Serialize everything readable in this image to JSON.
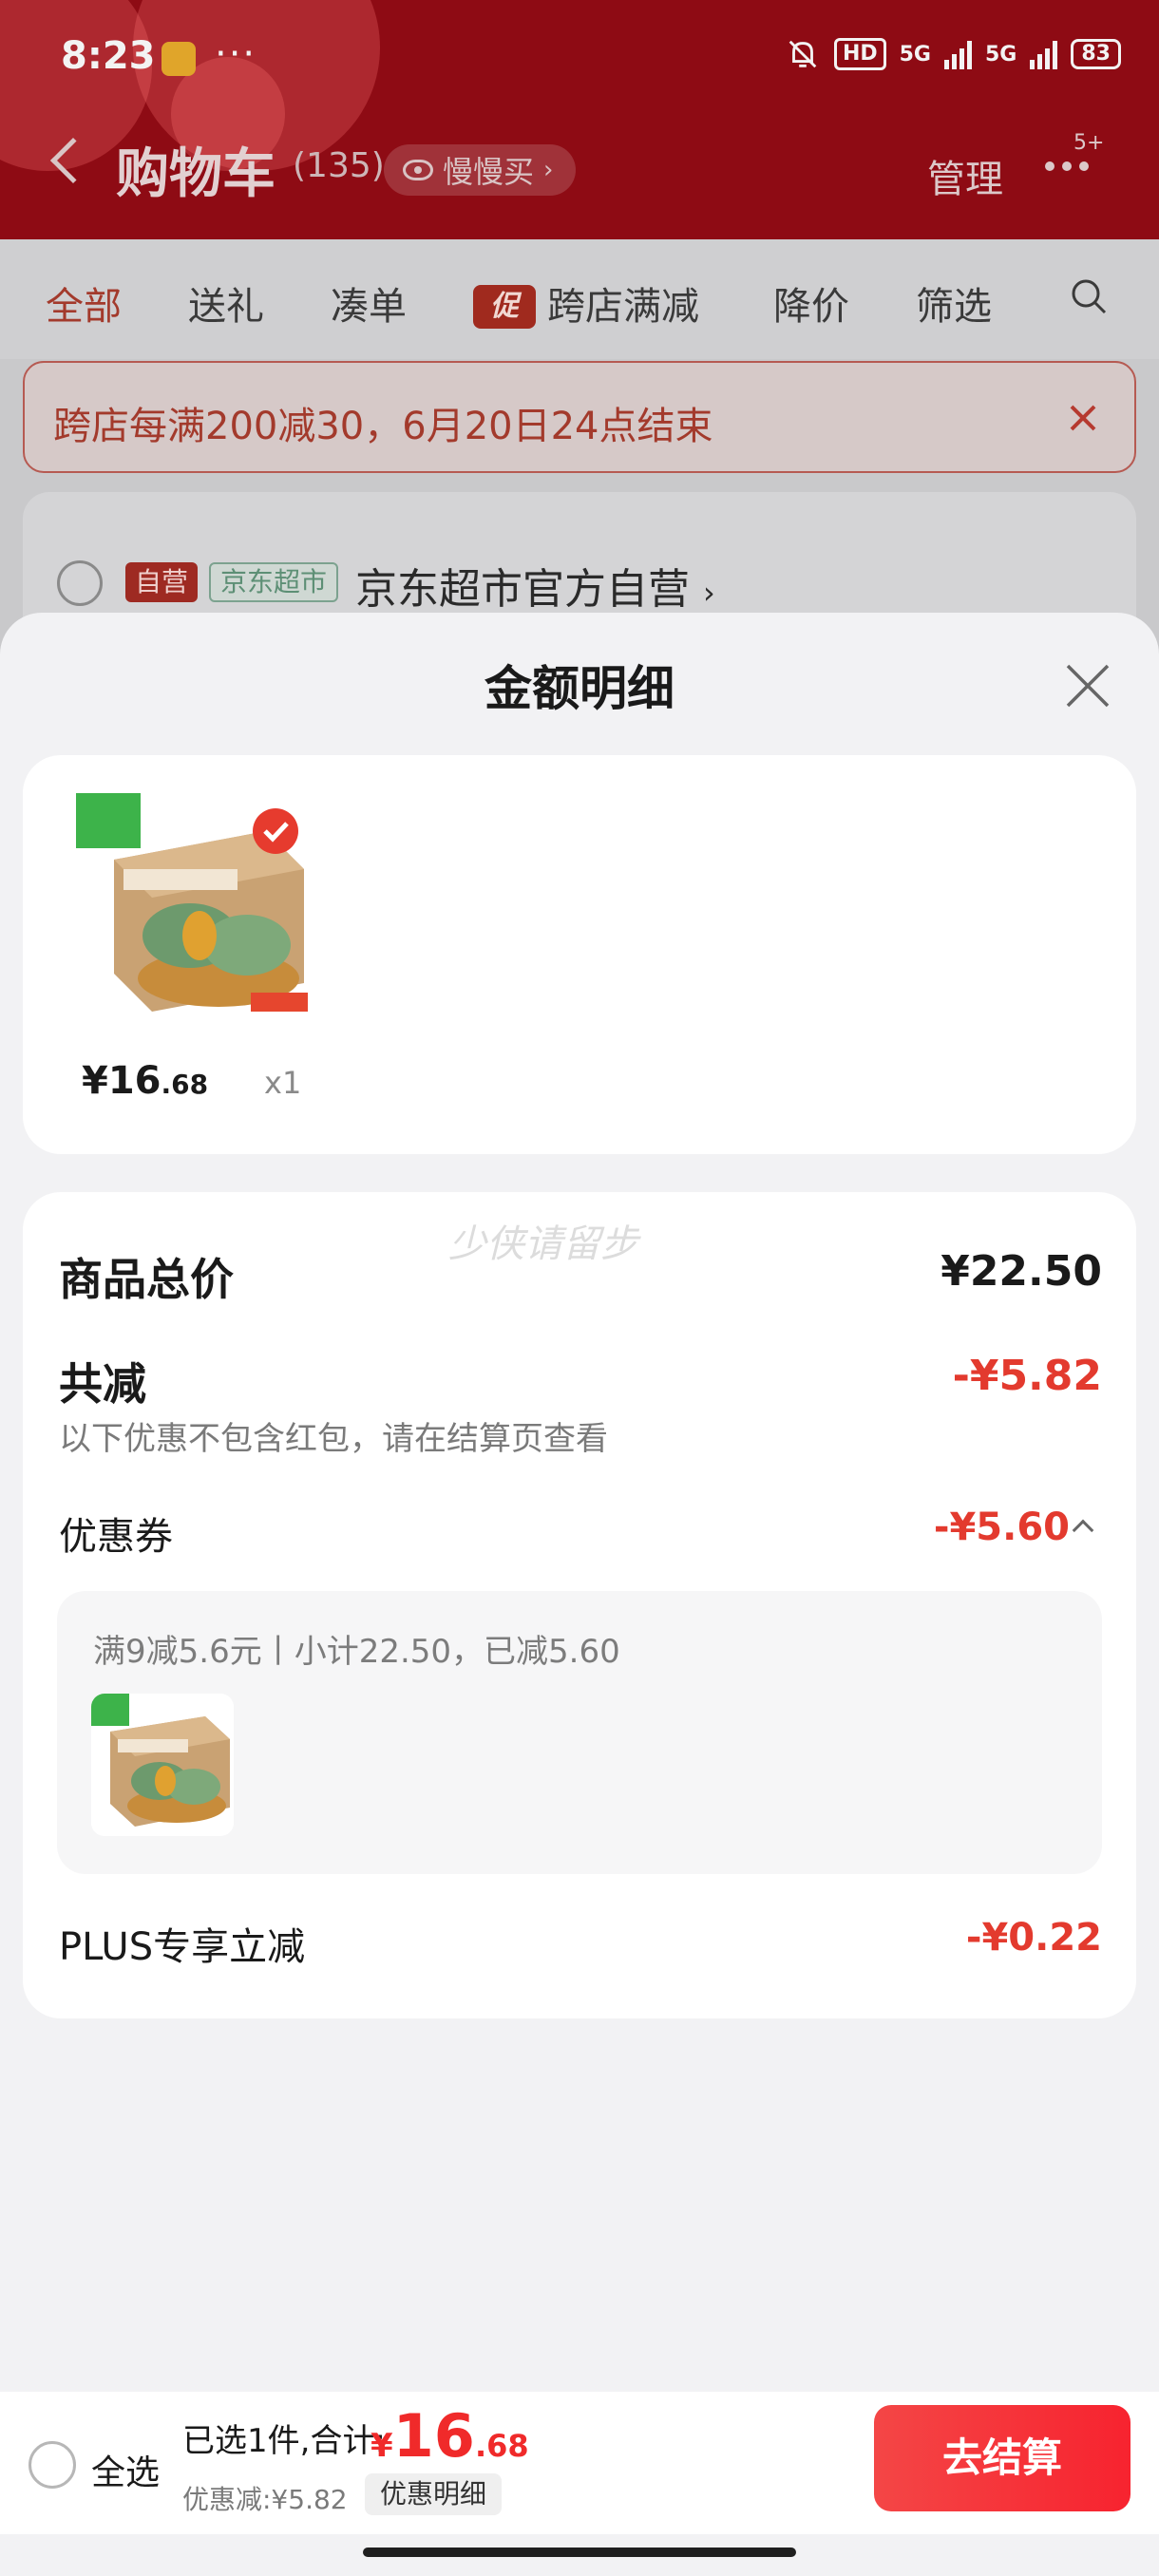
{
  "status": {
    "time": "8:23",
    "dots": "···",
    "hd": "HD",
    "net1": "5G",
    "net2": "5G",
    "battery": "83"
  },
  "nav": {
    "title": "购物车",
    "count": "(135)",
    "slow_buy": "慢慢买",
    "manage": "管理",
    "more_badge": "5+"
  },
  "tabs": {
    "all": "全部",
    "gift": "送礼",
    "bundle": "凑单",
    "promo_tag": "促",
    "cross_store": "跨店满减",
    "price_drop": "降价",
    "filter": "筛选"
  },
  "banner": {
    "text": "跨店每满200减30，6月20日24点结束"
  },
  "store": {
    "tag_self": "自营",
    "tag_jd": "京东超市",
    "name": "京东超市官方自营"
  },
  "sheet": {
    "title": "金额明细",
    "item": {
      "price_int": "¥16",
      "price_dec": ".68",
      "qty": "x1"
    },
    "watermark": "少侠请留步",
    "total_label": "商品总价",
    "total_value": "¥22.50",
    "reduce_label": "共减",
    "reduce_value": "-¥5.82",
    "reduce_note": "以下优惠不包含红包，请在结算页查看",
    "coupon_label": "优惠券",
    "coupon_value": "-¥5.60",
    "coupon_desc": "满9减5.6元丨小计22.50，已减5.60",
    "plus_label": "PLUS专享立减",
    "plus_value": "-¥0.22"
  },
  "checkout": {
    "select_all": "全选",
    "summary": "已选1件,合计:",
    "currency": "¥",
    "total_int": "16",
    "total_dec": ".68",
    "discount": "优惠减:¥5.82",
    "discount_detail": "优惠明细",
    "button": "去结算"
  },
  "colors": {
    "header_red": "#8e0b14",
    "accent_red": "#e33a2e",
    "checkout_red": "#f7232f"
  }
}
